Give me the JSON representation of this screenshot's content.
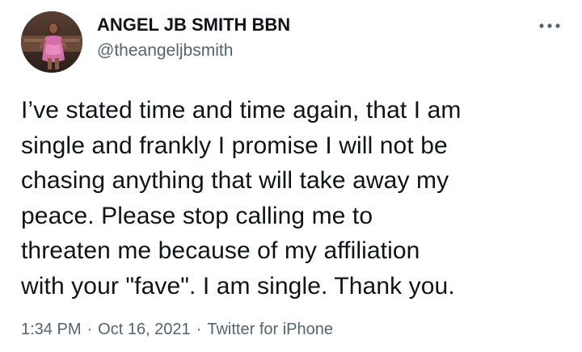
{
  "author": {
    "display_name": "ANGEL JB SMITH BBN",
    "handle": "@theangeljbsmith",
    "avatar_icon": "profile-photo-avatar"
  },
  "more_icon": "more-horizontal-icon",
  "tweet": {
    "lines": [
      "I’ve stated time and time again, that I am",
      "single and frankly I promise I will not be",
      "chasing anything that will take away my",
      "peace. Please stop calling me to",
      "threaten me because of my affiliation",
      "with your \"fave\". I am single. Thank you."
    ]
  },
  "meta": {
    "time": "1:34 PM",
    "separator": "·",
    "date": "Oct 16, 2021",
    "source": "Twitter for iPhone"
  },
  "colors": {
    "text_primary": "#0f1419",
    "text_secondary": "#536471",
    "background": "#ffffff"
  }
}
